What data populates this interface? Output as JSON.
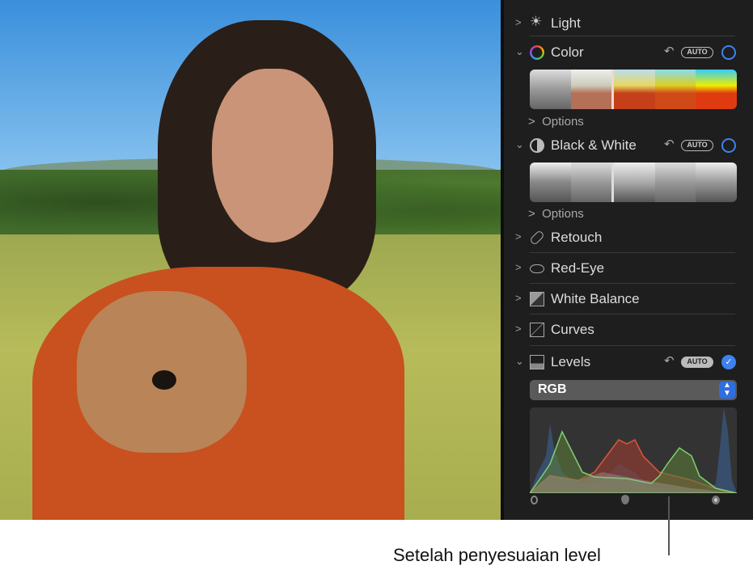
{
  "panel": {
    "sections": [
      {
        "label": "Light",
        "icon": "sun-icon",
        "expanded": false
      },
      {
        "label": "Color",
        "icon": "color-circle-icon",
        "expanded": true,
        "auto": "AUTO",
        "enabled": false
      },
      {
        "label": "Black & White",
        "icon": "half-circle-icon",
        "expanded": true,
        "auto": "AUTO",
        "enabled": false
      },
      {
        "label": "Retouch",
        "icon": "bandage-icon",
        "expanded": false
      },
      {
        "label": "Red-Eye",
        "icon": "eye-slash-icon",
        "expanded": false
      },
      {
        "label": "White Balance",
        "icon": "white-balance-icon",
        "expanded": false
      },
      {
        "label": "Curves",
        "icon": "curves-icon",
        "expanded": false
      },
      {
        "label": "Levels",
        "icon": "levels-icon",
        "expanded": true,
        "auto": "AUTO",
        "enabled": true
      }
    ],
    "options_label": "Options",
    "levels_channel": "RGB"
  },
  "callout": "Setelah penyesuaian level",
  "colors": {
    "accent": "#3d82f0",
    "panel_bg": "#1e1e1e",
    "shirt": "#c9501f"
  }
}
